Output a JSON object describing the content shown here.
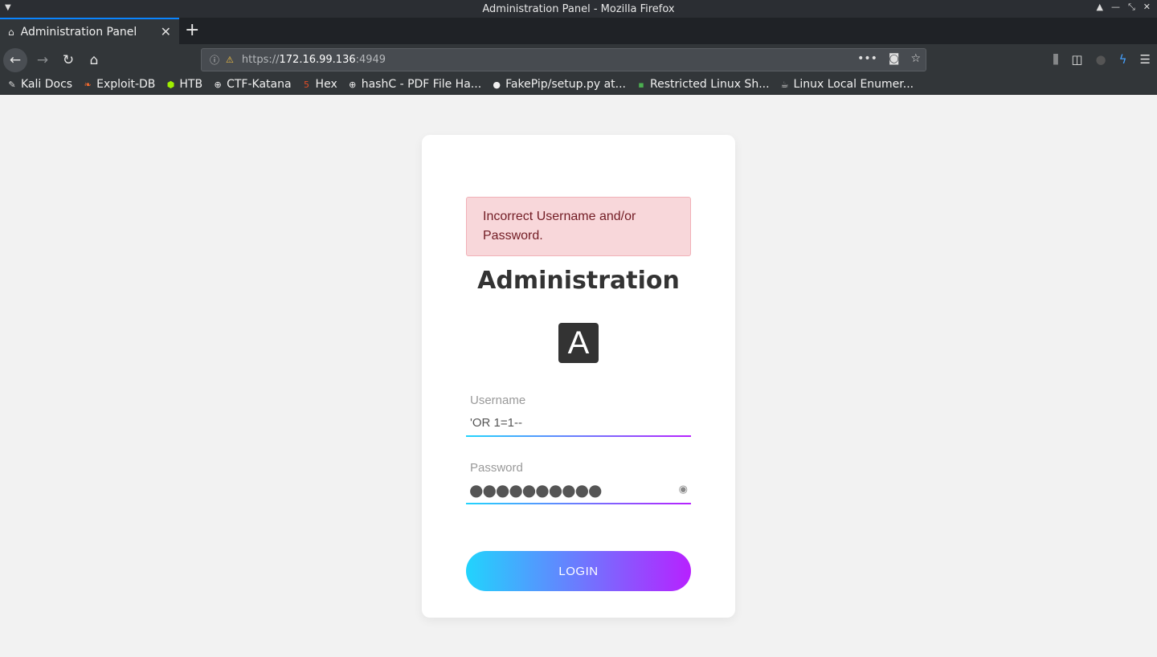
{
  "window": {
    "title": "Administration Panel - Mozilla Firefox"
  },
  "tab": {
    "title": "Administration Panel"
  },
  "url": {
    "scheme": "https://",
    "host": "172.16.99.136",
    "port": ":4949"
  },
  "bookmarks": [
    {
      "label": "Kali Docs",
      "icon": "kali-dragon-icon"
    },
    {
      "label": "Exploit-DB",
      "icon": "exploit-db-icon"
    },
    {
      "label": "HTB",
      "icon": "htb-cube-icon"
    },
    {
      "label": "CTF-Katana",
      "icon": "globe-icon"
    },
    {
      "label": "Hex",
      "icon": "html5-icon"
    },
    {
      "label": "hashC - PDF File Ha...",
      "icon": "globe-icon"
    },
    {
      "label": "FakePip/setup.py at...",
      "icon": "github-icon"
    },
    {
      "label": "Restricted Linux Sh...",
      "icon": "terminal-icon"
    },
    {
      "label": "Linux Local Enumer...",
      "icon": "coffee-icon"
    }
  ],
  "login": {
    "alert": "Incorrect Username and/or Password.",
    "heading": "Administration",
    "logo_letter": "A",
    "username_label": "Username",
    "username_value": "'OR 1=1--",
    "password_label": "Password",
    "password_mask": "●●●●●●●●●●",
    "button": "LOGIN"
  },
  "colors": {
    "gradient_start": "#21d4fd",
    "gradient_end": "#b721ff",
    "alert_bg": "#f8d7da",
    "alert_text": "#721c24"
  }
}
